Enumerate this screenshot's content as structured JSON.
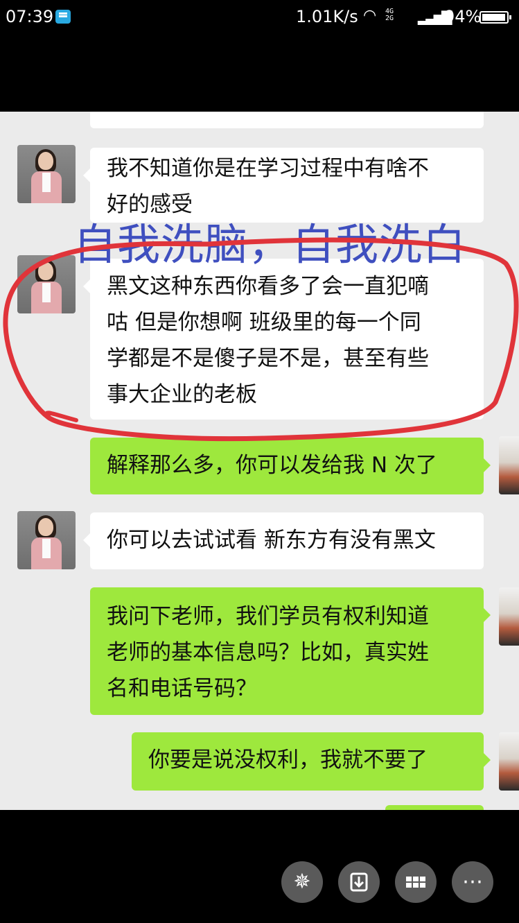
{
  "status_bar": {
    "time": "07:39",
    "network_speed": "1.01K/s",
    "network_type_top": "4G",
    "network_type_bottom": "2G",
    "battery_percent": "94%"
  },
  "annotation_text": "自我洗脑，自我洗白",
  "messages": [
    {
      "side": "left",
      "text_lines": [
        "我不知道你是在学习过程中有啥不",
        "好的感受"
      ]
    },
    {
      "side": "left",
      "text_lines": [
        "黑文这种东西你看多了会一直犯嘀",
        "咕 但是你想啊 班级里的每一个同",
        "学都是不是傻子是不是，甚至有些",
        "事大企业的老板"
      ]
    },
    {
      "side": "right",
      "text_lines": [
        "解释那么多，你可以发给我 N 次了"
      ]
    },
    {
      "side": "left",
      "text_lines": [
        "你可以去试试看 新东方有没有黑文"
      ]
    },
    {
      "side": "right",
      "text_lines": [
        "我问下老师，我们学员有权利知道",
        "老师的基本信息吗？比如，真实姓",
        "名和电话号码？"
      ]
    },
    {
      "side": "right",
      "text_lines": [
        "你要是说没权利，我就不要了"
      ]
    }
  ],
  "icons": {
    "bottom_buttons": [
      "pinwheel-icon",
      "download-icon",
      "grid-icon",
      "more-icon"
    ],
    "accent_colors": {
      "sent_bubble": "#9ee83d",
      "annotation": "#3f4fbf",
      "circle": "#e0343a"
    }
  }
}
